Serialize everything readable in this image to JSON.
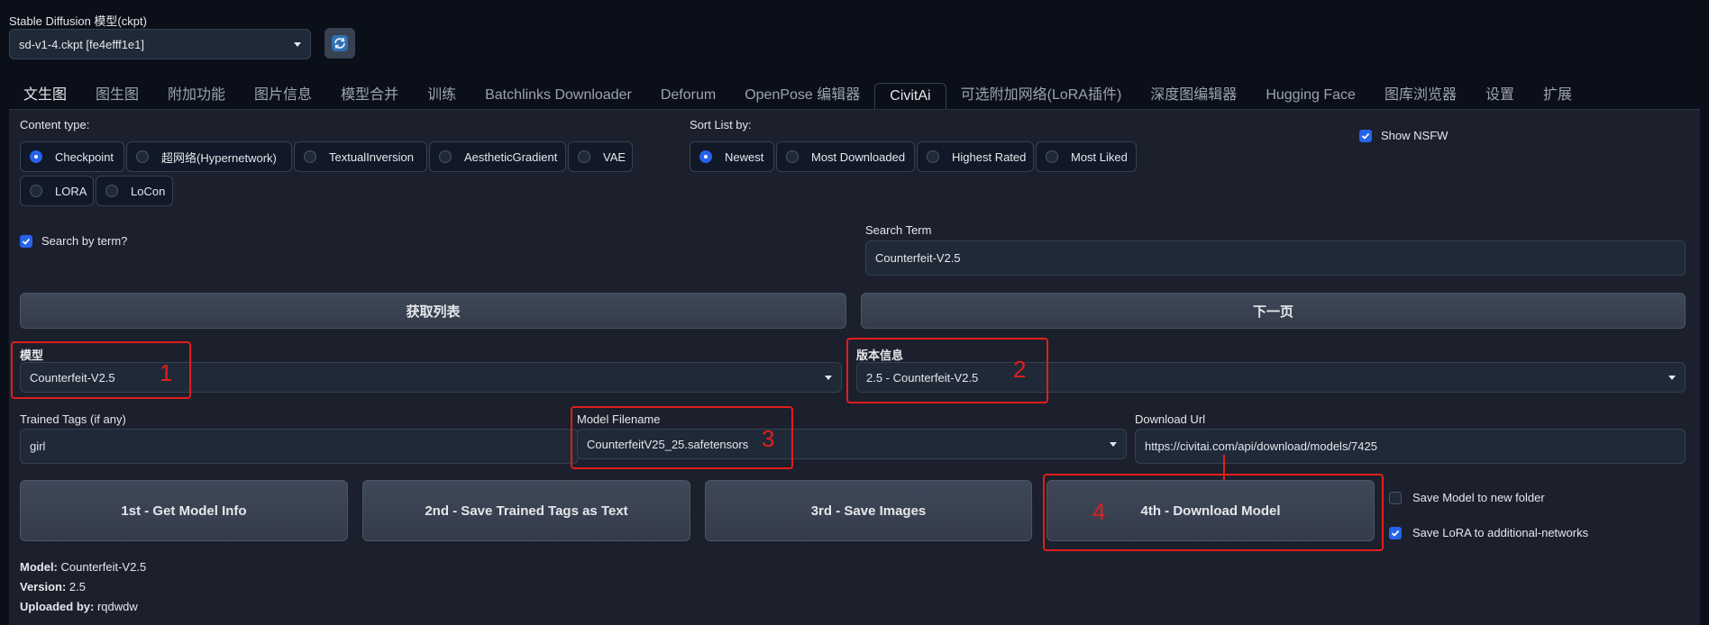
{
  "checkpoint": {
    "label": "Stable Diffusion 模型(ckpt)",
    "value": "sd-v1-4.ckpt [fe4efff1e1]"
  },
  "tabs": [
    "文生图",
    "图生图",
    "附加功能",
    "图片信息",
    "模型合并",
    "训练",
    "Batchlinks Downloader",
    "Deforum",
    "OpenPose 编辑器",
    "CivitAi",
    "可选附加网络(LoRA插件)",
    "深度图编辑器",
    "Hugging Face",
    "图库浏览器",
    "设置",
    "扩展"
  ],
  "content_type": {
    "label": "Content type:",
    "options": [
      "Checkpoint",
      "超网络(Hypernetwork)",
      "TextualInversion",
      "AestheticGradient",
      "VAE",
      "LORA",
      "LoCon"
    ],
    "selected": "Checkpoint"
  },
  "sort": {
    "label": "Sort List by:",
    "options": [
      "Newest",
      "Most Downloaded",
      "Highest Rated",
      "Most Liked"
    ],
    "selected": "Newest"
  },
  "show_nsfw": {
    "label": "Show NSFW",
    "checked": true
  },
  "search_by_term": {
    "label": "Search by term?",
    "checked": true
  },
  "search_term": {
    "label": "Search Term",
    "value": "Counterfeit-V2.5"
  },
  "buttons": {
    "get_list": "获取列表",
    "next_page": "下一页",
    "get_info": "1st - Get Model Info",
    "save_tags": "2nd - Save Trained Tags as Text",
    "save_images": "3rd - Save Images",
    "download": "4th - Download Model"
  },
  "model": {
    "label": "模型",
    "value": "Counterfeit-V2.5"
  },
  "version": {
    "label": "版本信息",
    "value": "2.5 - Counterfeit-V2.5"
  },
  "trained_tags": {
    "label": "Trained Tags (if any)",
    "value": "girl"
  },
  "model_filename": {
    "label": "Model Filename",
    "value": "CounterfeitV25_25.safetensors"
  },
  "download_url": {
    "label": "Download Url",
    "value": "https://civitai.com/api/download/models/7425"
  },
  "save_new_folder": {
    "label": "Save Model to new folder",
    "checked": false
  },
  "save_lora": {
    "label": "Save LoRA to additional-networks",
    "checked": true
  },
  "annotations": [
    "1",
    "2",
    "3",
    "4"
  ],
  "info": {
    "model_key": "Model:",
    "model_val": "Counterfeit-V2.5",
    "version_key": "Version:",
    "version_val": "2.5",
    "uploaded_key": "Uploaded by:",
    "uploaded_val": "rqdwdw"
  },
  "colors": {
    "accent": "#2563eb",
    "annotation": "#e11d1d",
    "background": "#0b0f19"
  }
}
